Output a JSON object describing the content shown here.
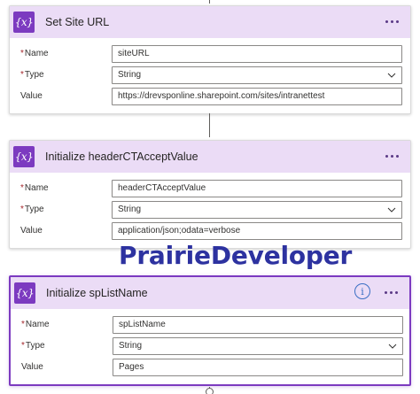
{
  "cards": [
    {
      "title": "Set Site URL",
      "fields": [
        {
          "label": "Name",
          "required": true,
          "value": "siteURL"
        },
        {
          "label": "Type",
          "required": true,
          "value": "String"
        },
        {
          "label": "Value",
          "required": false,
          "value": "https://drevsponline.sharepoint.com/sites/intranettest"
        }
      ]
    },
    {
      "title": "Initialize headerCTAcceptValue",
      "fields": [
        {
          "label": "Name",
          "required": true,
          "value": "headerCTAcceptValue"
        },
        {
          "label": "Type",
          "required": true,
          "value": "String"
        },
        {
          "label": "Value",
          "required": false,
          "value": "application/json;odata=verbose"
        }
      ]
    },
    {
      "title": "Initialize spListName",
      "fields": [
        {
          "label": "Name",
          "required": true,
          "value": "spListName"
        },
        {
          "label": "Type",
          "required": true,
          "value": "String"
        },
        {
          "label": "Value",
          "required": false,
          "value": "Pages"
        }
      ]
    }
  ],
  "icon": {
    "glyph": "{x}",
    "name": "variable-icon"
  },
  "required_marker": "*",
  "watermark": "PrairieDeveloper",
  "info_glyph": "i",
  "colors": {
    "header_bg": "#ebdcf6",
    "icon_bg": "#7c3ac0",
    "selected_border": "#7c3ac0",
    "watermark": "#2d32a0",
    "info": "#3a6fc4"
  }
}
